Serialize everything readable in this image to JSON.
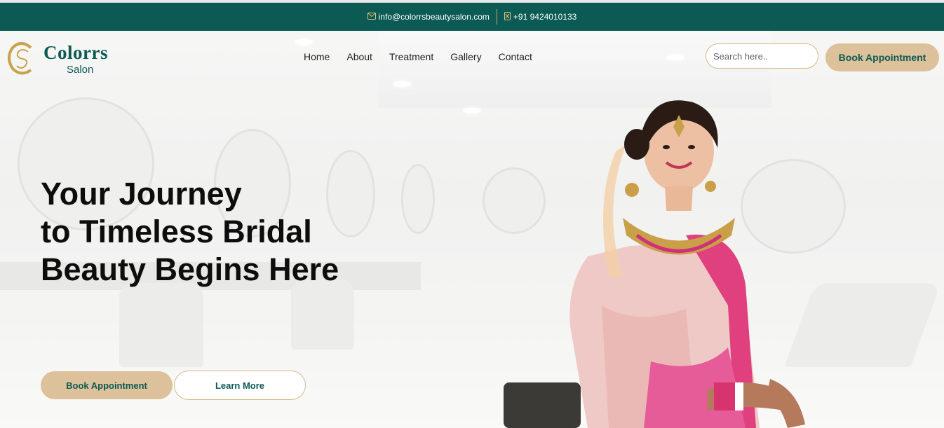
{
  "topbar": {
    "email": "info@colorrsbeautysalon.com",
    "email_icon": "envelope-icon",
    "phone": "+91 9424010133",
    "phone_icon": "phone-icon",
    "background": "#0b5a54",
    "icon_color": "#e2c27d"
  },
  "brand": {
    "name": "Colorrs",
    "sub": "Salon",
    "logo_icon": "cs-monogram-logo",
    "color": "#0b5a54",
    "gold": "#c8a24e"
  },
  "nav": {
    "items": [
      {
        "label": "Home"
      },
      {
        "label": "About"
      },
      {
        "label": "Treatment"
      },
      {
        "label": "Gallery"
      },
      {
        "label": "Contact"
      }
    ]
  },
  "search": {
    "placeholder": "Search here.."
  },
  "header_cta": {
    "label": "Book Appointment",
    "background": "#dcc19a"
  },
  "hero": {
    "headline_lines": [
      "Your Journey",
      "to Timeless Bridal",
      "Beauty Begins Here"
    ],
    "primary_cta": "Book Appointment",
    "secondary_cta": "Learn More"
  }
}
